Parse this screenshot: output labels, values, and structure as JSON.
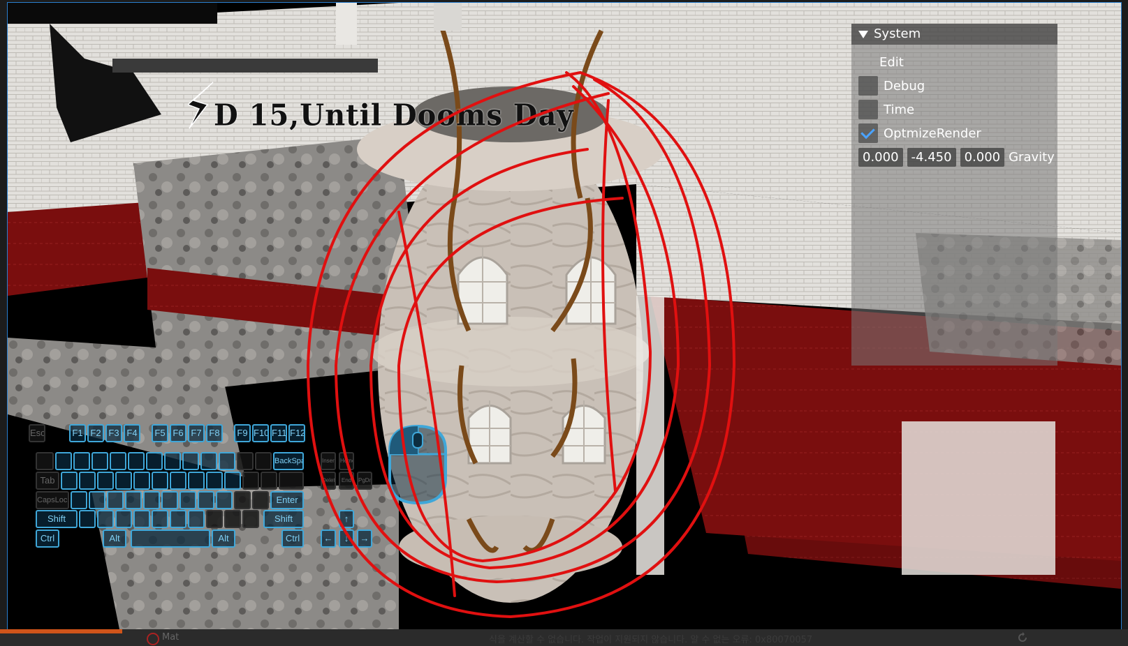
{
  "hud": {
    "title": "D 15,Until Dooms Day"
  },
  "panel": {
    "header": "System",
    "items": [
      {
        "label": "Edit",
        "checked": null
      },
      {
        "label": "Debug",
        "checked": false
      },
      {
        "label": "Time",
        "checked": false
      },
      {
        "label": "OptmizeRender",
        "checked": true
      }
    ],
    "gravity": {
      "x": "0.000",
      "y": "-4.450",
      "z": "0.000",
      "label": "Gravity"
    }
  },
  "keyboard": {
    "esc": "Esc",
    "f1": "F1",
    "f2": "F2",
    "f3": "F3",
    "f4": "F4",
    "f5": "F5",
    "f6": "F6",
    "f7": "F7",
    "f8": "F8",
    "f9": "F9",
    "f10": "F10",
    "f11": "F11",
    "f12": "F12",
    "backspace": "BackSpace",
    "tab": "Tab",
    "capslock": "CapsLock",
    "enter": "Enter",
    "shift_l": "Shift",
    "shift_r": "Shift",
    "ctrl_l": "Ctrl",
    "alt_l": "Alt",
    "alt_r": "Alt",
    "ctrl_r": "Ctrl",
    "insert": "Insert",
    "home": "Home",
    "delete": "Delete",
    "end": "End",
    "pgdn": "PgDn",
    "up": "↑",
    "left": "←",
    "down": "↓",
    "right": "→"
  },
  "statusbar": {
    "tab": "Mat",
    "message": "식을 계산할 수 없습니다. 작업이 지원되지 않습니다. 알 수 없는 오류: 0x80070057"
  },
  "colors": {
    "accent": "#3fa7d9",
    "annotation": "#e01010",
    "floor": "#7a0e0e"
  }
}
